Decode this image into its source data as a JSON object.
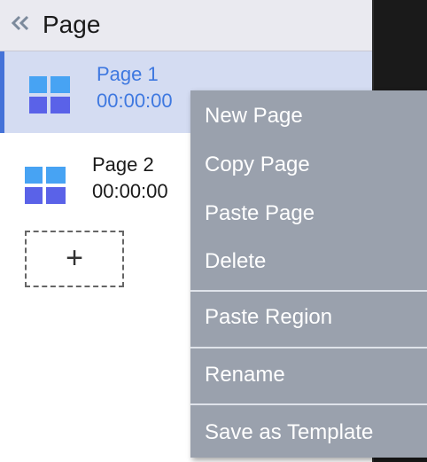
{
  "panel": {
    "title": "Page",
    "collapse_icon": "double-chevron-left-icon"
  },
  "pages": [
    {
      "name": "Page 1",
      "duration": "00:00:00",
      "selected": true,
      "icon": "page-grid-icon"
    },
    {
      "name": "Page 2",
      "duration": "00:00:00",
      "selected": false,
      "icon": "page-grid-icon"
    }
  ],
  "add_page": {
    "symbol": "+",
    "icon": "plus-icon"
  },
  "context_menu": {
    "items": [
      {
        "label": "New Page"
      },
      {
        "label": "Copy Page"
      },
      {
        "label": "Paste Page"
      },
      {
        "label": "Delete"
      },
      {
        "label": "Paste Region"
      },
      {
        "label": "Rename"
      },
      {
        "label": "Save as Template"
      }
    ]
  },
  "colors": {
    "accent": "#4472d8",
    "selected_bg": "#d4dcf2",
    "selected_text": "#3e78e0",
    "menu_bg": "#9aa1ad",
    "icon_light": "#47a3f3",
    "icon_dark": "#5a62e8"
  }
}
